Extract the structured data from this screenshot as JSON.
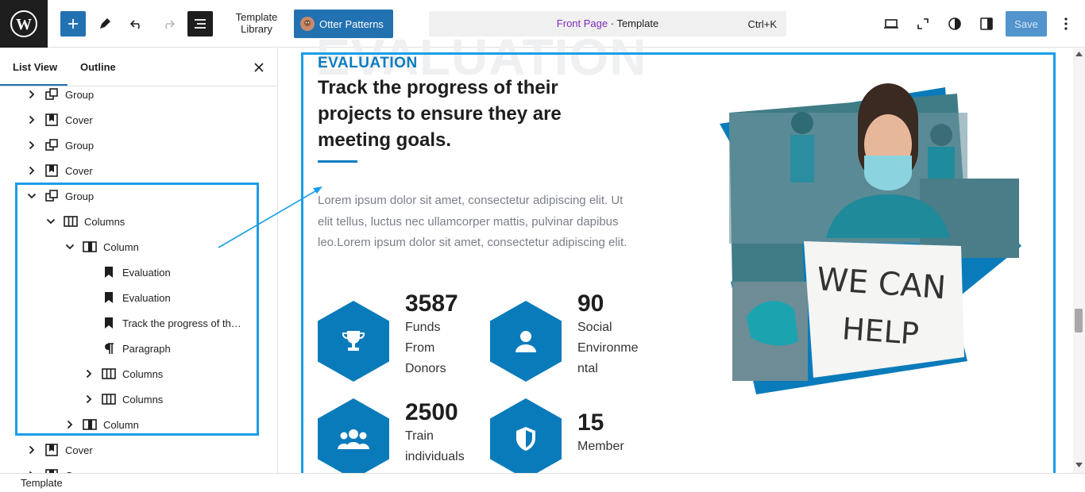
{
  "toolbar": {
    "template_library_line1": "Template",
    "template_library_line2": "Library",
    "otter_patterns": "Otter Patterns",
    "doc_title_page": "Front Page",
    "doc_title_sep": " · ",
    "doc_title_type": "Template",
    "shortcut": "Ctrl+K",
    "save_label": "Save"
  },
  "sidebar": {
    "tabs": [
      "List View",
      "Outline"
    ],
    "tree": [
      {
        "label": "Group",
        "icon": "group-icon",
        "level": 0,
        "chevron": "right"
      },
      {
        "label": "Cover",
        "icon": "cover-icon",
        "level": 0,
        "chevron": "right"
      },
      {
        "label": "Group",
        "icon": "group-icon",
        "level": 0,
        "chevron": "right"
      },
      {
        "label": "Cover",
        "icon": "cover-icon",
        "level": 0,
        "chevron": "right"
      },
      {
        "label": "Group",
        "icon": "group-icon",
        "level": 0,
        "chevron": "down"
      },
      {
        "label": "Columns",
        "icon": "columns-icon",
        "level": 1,
        "chevron": "down"
      },
      {
        "label": "Column",
        "icon": "column-icon",
        "level": 2,
        "chevron": "down"
      },
      {
        "label": "Evaluation",
        "icon": "bookmark-icon",
        "level": 3,
        "chevron": ""
      },
      {
        "label": "Evaluation",
        "icon": "bookmark-icon",
        "level": 3,
        "chevron": ""
      },
      {
        "label": "Track the progress of th…",
        "icon": "bookmark-icon",
        "level": 3,
        "chevron": ""
      },
      {
        "label": "Paragraph",
        "icon": "paragraph-icon",
        "level": 3,
        "chevron": ""
      },
      {
        "label": "Columns",
        "icon": "columns-icon",
        "level": 3,
        "chevron": "right"
      },
      {
        "label": "Columns",
        "icon": "columns-icon",
        "level": 3,
        "chevron": "right"
      },
      {
        "label": "Column",
        "icon": "column-icon",
        "level": 2,
        "chevron": "right"
      },
      {
        "label": "Cover",
        "icon": "cover-icon",
        "level": 0,
        "chevron": "right"
      },
      {
        "label": "Cover",
        "icon": "cover-icon",
        "level": 0,
        "chevron": "right"
      }
    ]
  },
  "content": {
    "ghost_heading": "EVALUATION",
    "eyebrow": "EVALUATION",
    "headline": "Track the progress of their projects to ensure they are meeting goals.",
    "paragraph": "Lorem ipsum dolor sit amet, consectetur adipiscing elit. Ut elit tellus, luctus nec ullamcorper mattis, pulvinar dapibus leo.Lorem ipsum dolor sit amet, consectetur adipiscing elit.",
    "stats": [
      {
        "number": "3587",
        "lines": [
          "Funds",
          "From",
          "Donors"
        ],
        "icon": "trophy-icon"
      },
      {
        "number": "90",
        "lines": [
          "Social",
          "Environme",
          "ntal"
        ],
        "icon": "person-icon"
      },
      {
        "number": "2500",
        "lines": [
          "Train",
          "individuals"
        ],
        "icon": "group-people-icon"
      },
      {
        "number": "15",
        "lines": [
          "Member"
        ],
        "icon": "shield-icon"
      }
    ],
    "sign_text_1": "WE CAN",
    "sign_text_2": "HELP"
  },
  "footer": {
    "label": "Template"
  },
  "colors": {
    "accent": "#2271b1",
    "brand_blue": "#0a7bba",
    "selection": "#1a9ee8"
  }
}
